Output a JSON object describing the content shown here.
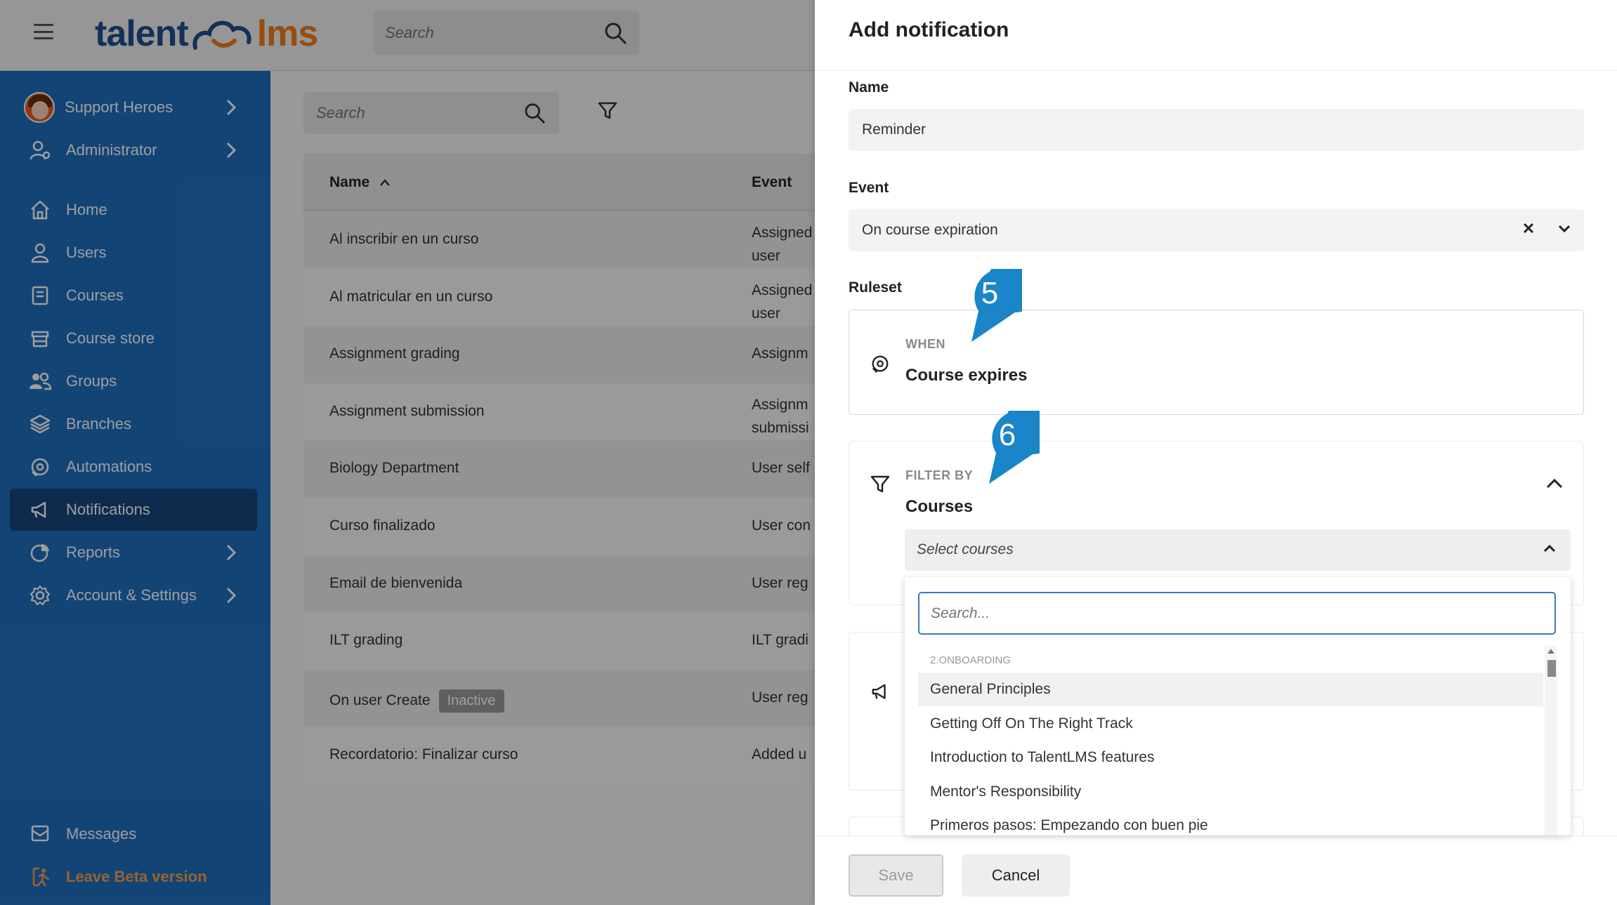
{
  "topbar": {
    "logo_left": "talent",
    "logo_right": "lms",
    "search_placeholder": "Search"
  },
  "sidebar": {
    "branch": "Support Heroes",
    "role": "Administrator",
    "items": [
      {
        "label": "Home",
        "icon": "home-icon"
      },
      {
        "label": "Users",
        "icon": "user-icon"
      },
      {
        "label": "Courses",
        "icon": "book-icon"
      },
      {
        "label": "Course store",
        "icon": "store-icon"
      },
      {
        "label": "Groups",
        "icon": "group-icon"
      },
      {
        "label": "Branches",
        "icon": "layers-icon"
      },
      {
        "label": "Automations",
        "icon": "automation-icon"
      },
      {
        "label": "Notifications",
        "icon": "megaphone-icon"
      },
      {
        "label": "Reports",
        "icon": "pie-chart-icon"
      },
      {
        "label": "Account & Settings",
        "icon": "gear-icon"
      }
    ],
    "messages": "Messages",
    "leave_beta": "Leave Beta version",
    "accent": "#1f6fbf",
    "active_bg": "#17467e",
    "beta_color": "#f7a14a"
  },
  "main": {
    "search_placeholder": "Search",
    "columns": {
      "name": "Name",
      "event": "Event"
    },
    "rows": [
      {
        "name": "Al inscribir en un curso",
        "event": "Assigned user",
        "badge": ""
      },
      {
        "name": "Al matricular en un curso",
        "event": "Assigned user",
        "badge": ""
      },
      {
        "name": "Assignment grading",
        "event": "Assignm",
        "badge": ""
      },
      {
        "name": "Assignment submission",
        "event": "Assignm submissi",
        "badge": ""
      },
      {
        "name": "Biology Department",
        "event": "User self",
        "badge": ""
      },
      {
        "name": "Curso finalizado",
        "event": "User con",
        "badge": ""
      },
      {
        "name": "Email de bienvenida",
        "event": "User reg",
        "badge": ""
      },
      {
        "name": "ILT grading",
        "event": "ILT gradi",
        "badge": ""
      },
      {
        "name": "On user Create",
        "event": "User reg",
        "badge": "Inactive"
      },
      {
        "name": "Recordatorio: Finalizar curso",
        "event": "Added u",
        "badge": ""
      }
    ]
  },
  "drawer": {
    "title": "Add notification",
    "name_label": "Name",
    "name_value": "Reminder",
    "event_label": "Event",
    "event_value": "On course expiration",
    "ruleset_label": "Ruleset",
    "when_label": "WHEN",
    "when_value": "Course expires",
    "filter_label": "FILTER BY",
    "filter_value": "Courses",
    "select_placeholder": "Select courses",
    "dropdown": {
      "search_placeholder": "Search...",
      "group": "2.ONBOARDING",
      "options": [
        "General Principles",
        "Getting Off On The Right Track",
        "Introduction to TalentLMS features",
        "Mentor's Responsibility",
        "Primeros pasos: Empezando con buen pie"
      ]
    },
    "callouts": [
      "5",
      "6"
    ],
    "callout_color": "#1a85c8",
    "save": "Save",
    "cancel": "Cancel"
  }
}
